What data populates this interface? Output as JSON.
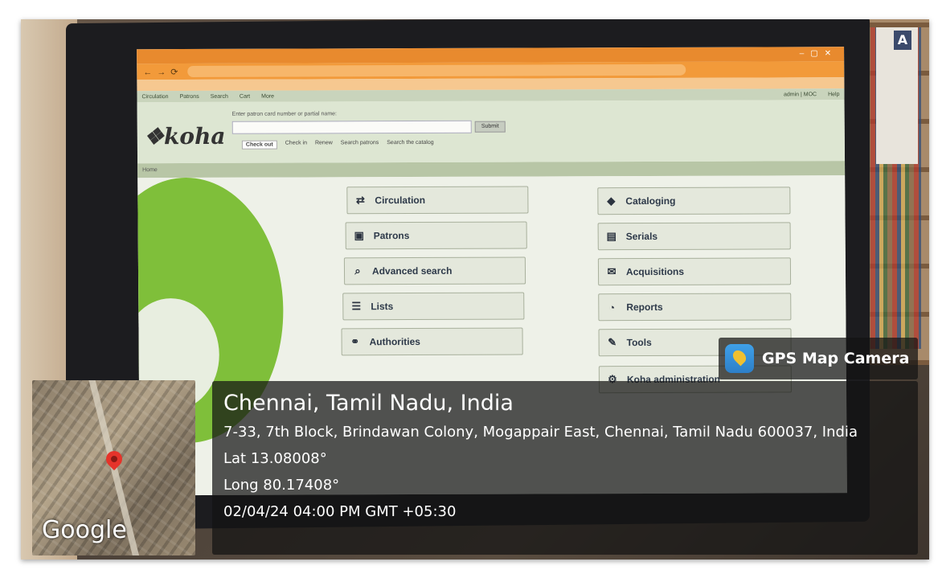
{
  "koha": {
    "hint": "Enter patron card number or partial name:",
    "submit": "Submit",
    "tabs": [
      "Check out",
      "Check in",
      "Renew",
      "Search patrons",
      "Search the catalog"
    ],
    "top_left": [
      "Circulation",
      "Patrons",
      "Search",
      "Cart",
      "More"
    ],
    "top_right": [
      "admin | MOC",
      "Help"
    ],
    "crumb": "Home",
    "tiles_left": [
      {
        "label": "Circulation",
        "icon": "⇄"
      },
      {
        "label": "Patrons",
        "icon": "▣"
      },
      {
        "label": "Advanced search",
        "icon": "⌕"
      },
      {
        "label": "Lists",
        "icon": "☰"
      },
      {
        "label": "Authorities",
        "icon": "⚭"
      }
    ],
    "tiles_right": [
      {
        "label": "Cataloging",
        "icon": "◆"
      },
      {
        "label": "Serials",
        "icon": "▤"
      },
      {
        "label": "Acquisitions",
        "icon": "✉"
      },
      {
        "label": "Reports",
        "icon": "◔"
      },
      {
        "label": "Tools",
        "icon": "✎"
      },
      {
        "label": "Koha administration",
        "icon": "⚙"
      }
    ]
  },
  "overlay": {
    "app": "GPS Map Camera",
    "city": "Chennai, Tamil Nadu, India",
    "address": "7-33, 7th Block, Brindawan Colony, Mogappair East, Chennai, Tamil Nadu 600037, India",
    "lat": "Lat 13.08008°",
    "long": "Long 80.17408°",
    "datetime": "02/04/24 04:00 PM GMT +05:30",
    "map_brand": "Google"
  }
}
